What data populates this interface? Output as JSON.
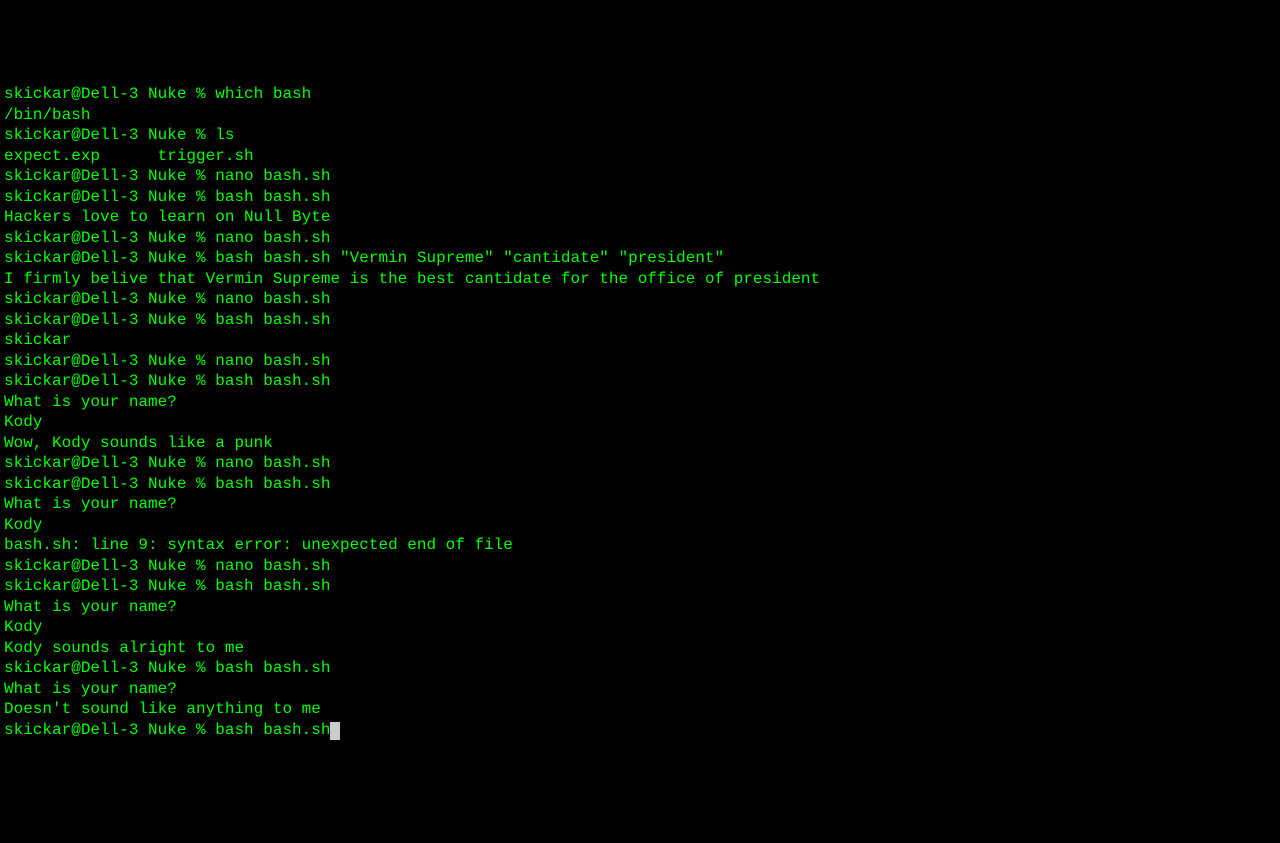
{
  "prompt": "skickar@Dell-3 Nuke % ",
  "lines": [
    {
      "type": "cmd",
      "text": "which bash"
    },
    {
      "type": "out",
      "text": "/bin/bash"
    },
    {
      "type": "cmd",
      "text": "ls"
    },
    {
      "type": "out",
      "text": "expect.exp      trigger.sh"
    },
    {
      "type": "cmd",
      "text": "nano bash.sh"
    },
    {
      "type": "cmd",
      "text": "bash bash.sh"
    },
    {
      "type": "out",
      "text": "Hackers love to learn on Null Byte"
    },
    {
      "type": "cmd",
      "text": "nano bash.sh"
    },
    {
      "type": "cmd",
      "text": "bash bash.sh \"Vermin Supreme\" \"cantidate\" \"president\""
    },
    {
      "type": "out",
      "text": "I firmly belive that Vermin Supreme is the best cantidate for the office of president"
    },
    {
      "type": "cmd",
      "text": "nano bash.sh"
    },
    {
      "type": "cmd",
      "text": "bash bash.sh"
    },
    {
      "type": "out",
      "text": "skickar"
    },
    {
      "type": "cmd",
      "text": "nano bash.sh"
    },
    {
      "type": "cmd",
      "text": "bash bash.sh"
    },
    {
      "type": "out",
      "text": "What is your name?"
    },
    {
      "type": "out",
      "text": "Kody"
    },
    {
      "type": "out",
      "text": "Wow, Kody sounds like a punk"
    },
    {
      "type": "cmd",
      "text": "nano bash.sh"
    },
    {
      "type": "cmd",
      "text": "bash bash.sh"
    },
    {
      "type": "out",
      "text": "What is your name?"
    },
    {
      "type": "out",
      "text": "Kody"
    },
    {
      "type": "out",
      "text": "bash.sh: line 9: syntax error: unexpected end of file"
    },
    {
      "type": "cmd",
      "text": "nano bash.sh"
    },
    {
      "type": "cmd",
      "text": "bash bash.sh"
    },
    {
      "type": "out",
      "text": "What is your name?"
    },
    {
      "type": "out",
      "text": "Kody"
    },
    {
      "type": "out",
      "text": "Kody sounds alright to me"
    },
    {
      "type": "cmd",
      "text": "bash bash.sh"
    },
    {
      "type": "out",
      "text": "What is your name?"
    },
    {
      "type": "out",
      "text": ""
    },
    {
      "type": "out",
      "text": "Doesn't sound like anything to me"
    },
    {
      "type": "cmd",
      "text": "bash bash.sh",
      "cursor": true
    }
  ]
}
